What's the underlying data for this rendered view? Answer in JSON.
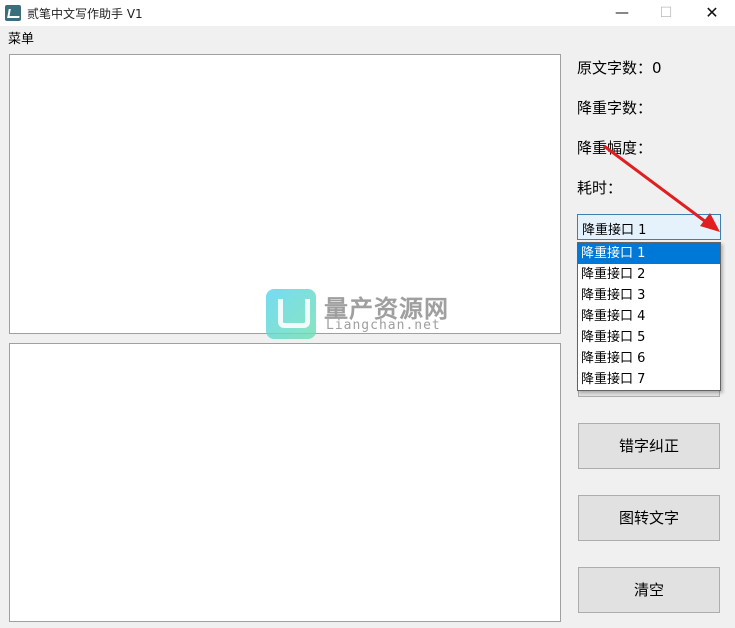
{
  "window": {
    "title": "贰笔中文写作助手 V1",
    "minimize_glyph": "—",
    "maximize_glyph": "☐",
    "close_glyph": "✕"
  },
  "menu": {
    "label": "菜单"
  },
  "stats": {
    "original_count": "原文字数：0",
    "reduced_count": "降重字数：",
    "reduction_rate": "降重幅度：",
    "elapsed": "耗时："
  },
  "api_select": {
    "selected": "降重接口 1",
    "arrow_glyph": "▾",
    "options": [
      "降重接口 1",
      "降重接口 2",
      "降重接口 3",
      "降重接口 4",
      "降重接口 5",
      "降重接口 6",
      "降重接口 7"
    ]
  },
  "buttons": {
    "correct": "错字纠正",
    "ocr": "图转文字",
    "clear": "清空"
  },
  "watermark": {
    "cn": "量产资源网",
    "en": "Liangchan.net"
  },
  "colors": {
    "accent": "#0078d7",
    "annotation_arrow": "#e02020"
  }
}
